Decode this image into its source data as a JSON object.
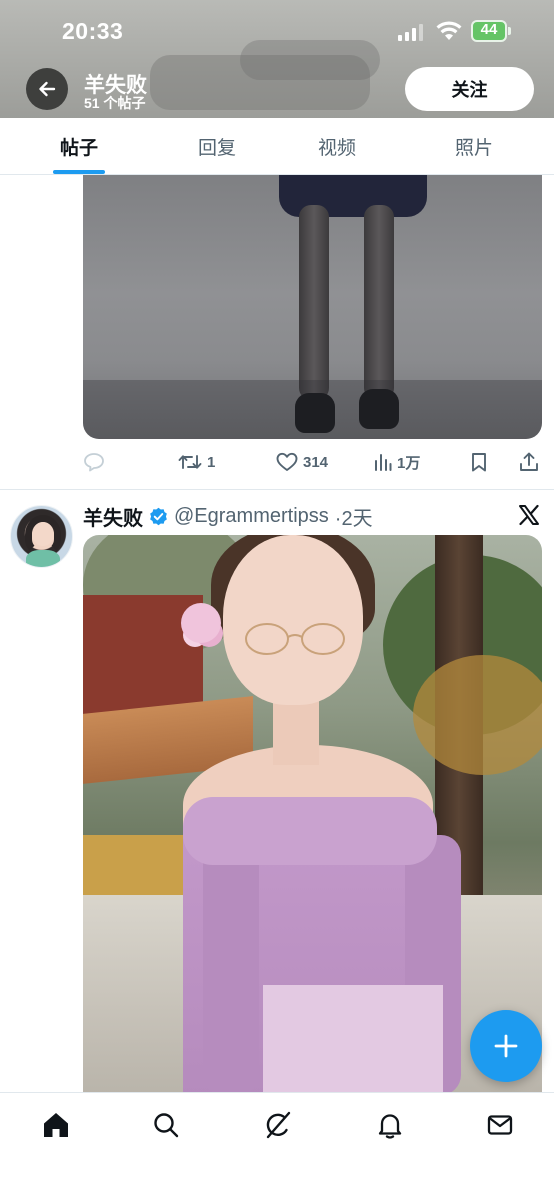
{
  "status_bar": {
    "time": "20:33",
    "battery_level": "44"
  },
  "header": {
    "name": "羊失败",
    "post_count": "51 个帖子",
    "follow_label": "关注"
  },
  "tabs": [
    {
      "label": "帖子",
      "active": true
    },
    {
      "label": "回复",
      "active": false
    },
    {
      "label": "视频",
      "active": false
    },
    {
      "label": "照片",
      "active": false
    }
  ],
  "post1": {
    "actions": {
      "reply_count": "",
      "retweet_count": "1",
      "like_count": "314",
      "view_count": "1万"
    }
  },
  "post2": {
    "name": "羊失败",
    "verified": true,
    "handle": "@Egrammertipss",
    "time": "·2天"
  },
  "colors": {
    "accent": "#1d9bf0",
    "text_primary": "#0f1419",
    "text_secondary": "#536471",
    "battery": "#65c466"
  },
  "icons": {
    "back": "arrow-left-icon",
    "reply": "speech-bubble-icon",
    "retweet": "retweet-icon",
    "like": "heart-icon",
    "views": "bar-chart-icon",
    "bookmark": "bookmark-icon",
    "share": "share-icon",
    "verified": "verified-badge-icon",
    "platform": "x-logo-icon",
    "compose": "plus-icon",
    "nav": [
      "home-icon",
      "search-icon",
      "grok-icon",
      "bell-icon",
      "mail-icon"
    ]
  }
}
